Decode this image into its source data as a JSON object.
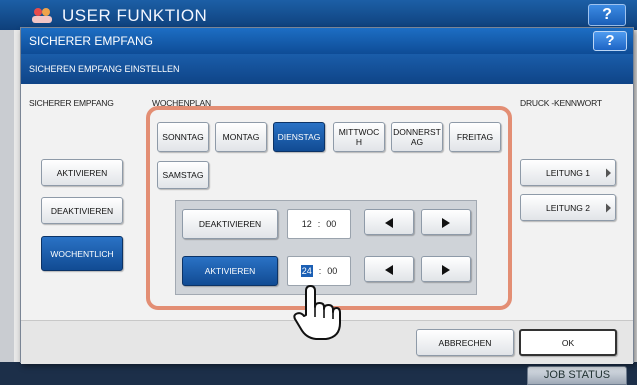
{
  "background": {
    "title": "USER FUNKTION",
    "help": "?",
    "job_status": "JOB STATUS"
  },
  "dialog": {
    "title": "SICHERER EMPFANG",
    "help": "?",
    "subtitle": "SICHEREN EMPFANG EINSTELLEN"
  },
  "left": {
    "label": "SICHERER EMPFANG",
    "buttons": [
      {
        "label": "AKTIVIEREN",
        "active": false
      },
      {
        "label": "DEAKTIVIEREN",
        "active": false
      },
      {
        "label": "WOCHENTLICH",
        "active": true
      }
    ]
  },
  "weekplan": {
    "label": "WOCHENPLAN",
    "days": [
      {
        "label": "SONNTAG",
        "active": false
      },
      {
        "label": "MONTAG",
        "active": false
      },
      {
        "label": "DIENSTAG",
        "active": true
      },
      {
        "label": "MITTWOCH",
        "active": false
      },
      {
        "label": "DONNERSTAG",
        "active": false
      },
      {
        "label": "FREITAG",
        "active": false
      },
      {
        "label": "SAMSTAG",
        "active": false
      }
    ],
    "day_display": {
      "mittwoch_line1": "MITTWOC",
      "mittwoch_line2": "H",
      "donnerstag_line1": "DONNERST",
      "donnerstag_line2": "AG"
    },
    "rows": [
      {
        "label": "DEAKTIVIEREN",
        "active": false,
        "hour": "12",
        "sep": ":",
        "minute": "00"
      },
      {
        "label": "AKTIVIEREN",
        "active": true,
        "hour": "24",
        "sep": ":",
        "minute": "00"
      }
    ]
  },
  "print_password": {
    "label": "DRUCK -KENNWORT",
    "buttons": [
      "LEITUNG 1",
      "LEITUNG 2"
    ]
  },
  "footer": {
    "cancel": "ABBRECHEN",
    "ok": "OK"
  },
  "colors": {
    "header_blue": "#0e4c96",
    "active_blue": "#114b93",
    "highlight_border": "#e38e74"
  }
}
